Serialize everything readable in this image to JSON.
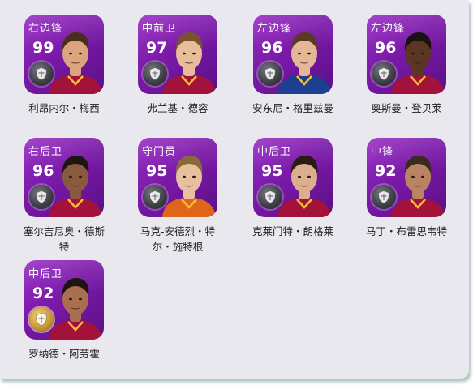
{
  "players": [
    {
      "position": "右边锋",
      "rating": "99",
      "name": "利昂内尔・梅西",
      "badge": "silver",
      "skin": "#d9a47e",
      "hair": "#4a2e1c",
      "kit": "#a3123a"
    },
    {
      "position": "中前卫",
      "rating": "97",
      "name": "弗兰基・德容",
      "badge": "silver",
      "skin": "#e8bd9a",
      "hair": "#7a5230",
      "kit": "#a3123a"
    },
    {
      "position": "左边锋",
      "rating": "96",
      "name": "安东尼・格里兹曼",
      "badge": "silver",
      "skin": "#e4b796",
      "hair": "#5a3a24",
      "kit": "#1d3f8f"
    },
    {
      "position": "左边锋",
      "rating": "96",
      "name": "奥斯曼・登贝莱",
      "badge": "silver",
      "skin": "#5a3624",
      "hair": "#1a1210",
      "kit": "#a3123a"
    },
    {
      "position": "右后卫",
      "rating": "96",
      "name": "塞尔吉尼奥・德斯特",
      "badge": "silver",
      "skin": "#8a5a3e",
      "hair": "#1e1410",
      "kit": "#a3123a"
    },
    {
      "position": "守门员",
      "rating": "95",
      "name": "马克-安德烈・特尔・施特根",
      "badge": "silver",
      "skin": "#e8c0a0",
      "hair": "#8a6a3a",
      "kit": "#e0651a"
    },
    {
      "position": "中后卫",
      "rating": "95",
      "name": "克莱门特・朗格莱",
      "badge": "silver",
      "skin": "#dcae8c",
      "hair": "#2a1c14",
      "kit": "#a3123a"
    },
    {
      "position": "中锋",
      "rating": "92",
      "name": "马丁・布雷思韦特",
      "badge": "silver",
      "skin": "#b88462",
      "hair": "#3a2a20",
      "kit": "#a3123a"
    },
    {
      "position": "中后卫",
      "rating": "92",
      "name": "罗纳德・阿劳霍",
      "badge": "gold",
      "skin": "#a8704e",
      "hair": "#1e1410",
      "kit": "#a3123a"
    }
  ],
  "icons": {
    "badge": "shield-emblem-icon"
  },
  "colors": {
    "tile_top": "#9a30c6",
    "tile_bottom": "#5a0f86",
    "panel": "#e8e8ee"
  }
}
